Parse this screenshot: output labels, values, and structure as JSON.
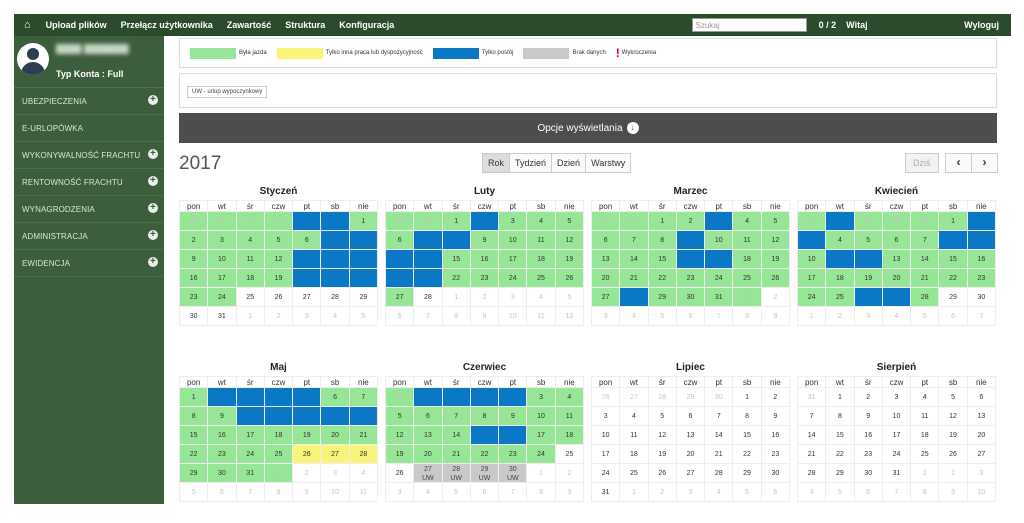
{
  "topbar": {
    "upload": "Upload plików",
    "switch_user": "Przełącz użytkownika",
    "content": "Zawartość",
    "structure": "Struktura",
    "config": "Konfiguracja",
    "search_placeholder": "Szukaj",
    "counter": "0 / 2",
    "welcome": "Witaj",
    "logout": "Wyloguj"
  },
  "sidebar": {
    "account": "Typ Konta : Full",
    "items": [
      {
        "label": "UBEZPIECZENIA",
        "plus": true
      },
      {
        "label": "E-URLOPÓWKA",
        "plus": false
      },
      {
        "label": "WYKONYWALNOŚĆ FRACHTU",
        "plus": true
      },
      {
        "label": "RENTOWNOŚĆ FRACHTU",
        "plus": true
      },
      {
        "label": "WYNAGRODZENIA",
        "plus": true
      },
      {
        "label": "ADMINISTRACJA",
        "plus": true
      },
      {
        "label": "EWIDENCJA",
        "plus": true
      }
    ]
  },
  "legend": [
    {
      "label": "Była jazda",
      "color": "#97e597"
    },
    {
      "label": "Tylko inna praca lub dyspozycyjność",
      "color": "#faf57a"
    },
    {
      "label": "Tylko postój",
      "color": "#0a78c4"
    },
    {
      "label": "Brak danych",
      "color": "#c9c9c9"
    },
    {
      "label": "Wykroczenia",
      "icon": "exclamation-icon",
      "color": "#d9001b"
    }
  ],
  "uw_legend": "UW - urlop wypoczynkowy",
  "options_label": "Opcje wyświetlania",
  "year": "2017",
  "views": [
    "Rok",
    "Tydzień",
    "Dzień",
    "Warstwy"
  ],
  "active_view": "Rok",
  "today_label": "Dziś",
  "weekdays": [
    "pon",
    "wt",
    "śr",
    "czw",
    "pt",
    "sb",
    "nie"
  ],
  "months": [
    {
      "name": "Styczeń",
      "first_weekday": 6,
      "days": 31,
      "prev_days": 31,
      "status": "ggggbbggggggbbggggbbbggggbbbgg"
    },
    {
      "name": "Luty",
      "first_weekday": 2,
      "days": 28,
      "prev_days": 31,
      "status": "gggbggggbbggggbbgggggbbgggggg"
    },
    {
      "name": "Marzec",
      "first_weekday": 2,
      "days": 31,
      "prev_days": 28,
      "status": "ggggbgggggbggggggbbggggggggggbgggg"
    },
    {
      "name": "Kwiecień",
      "first_weekday": 5,
      "days": 30,
      "prev_days": 31,
      "status": "gbggggbbggggbbgbbgggggggggggggbbg"
    },
    {
      "name": "Maj",
      "first_weekday": 0,
      "days": 31,
      "prev_days": 30,
      "status": "gbbbbggggbbbbbgggggggggggyyygggg"
    },
    {
      "name": "Czerwiec",
      "first_weekday": 3,
      "days": 30,
      "prev_days": 31,
      "status": "gbbbbggggggggggggbbgggggggg"
    },
    {
      "name": "Lipiec",
      "first_weekday": 5,
      "days": 31,
      "prev_days": 30,
      "status": ""
    },
    {
      "name": "Sierpień",
      "first_weekday": 1,
      "days": 31,
      "prev_days": 31,
      "status": ""
    }
  ],
  "june_uw": {
    "days": [
      27,
      28,
      29,
      30
    ],
    "label": "UW"
  }
}
